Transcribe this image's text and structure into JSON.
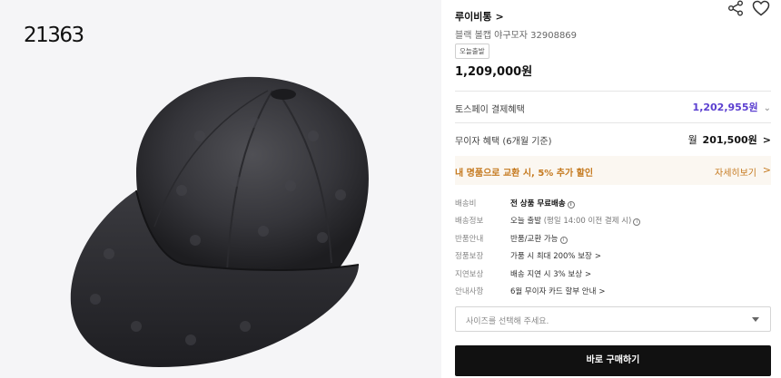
{
  "image_panel": {
    "image_id": "21363"
  },
  "product": {
    "brand": "루이비통",
    "brand_chevron": ">",
    "name": "블랙 볼캡 야구모자 32908869",
    "badge": "오늘출발",
    "price": "1,209,000원"
  },
  "benefits": {
    "toss_label": "토스페이 결제혜택",
    "toss_value": "1,202,955원",
    "toss_chevron": "⌄",
    "interest_label": "무이자 혜택 (6개월 기준)",
    "interest_prefix": "월",
    "interest_value": "201,500원",
    "interest_chevron": ">"
  },
  "exchange": {
    "label": "내 명품으로 교환 시, 5% 추가 할인",
    "link": "자세히보기",
    "chevron": ">"
  },
  "shipping": {
    "fee_label": "배송비",
    "fee_value": "전 상품 무료배송",
    "info_label": "배송정보",
    "info_value": "오늘 출발",
    "info_sub": "(평일 14:00 이전 결제 시)",
    "return_label": "반품안내",
    "return_value": "반품/교환 가능",
    "guarantee_label": "정품보장",
    "guarantee_value": "가품 시 최대 200% 보장",
    "delay_label": "지연보상",
    "delay_value": "배송 지연 시 3% 보상",
    "notice_label": "안내사항",
    "notice_value": "6월 무이자 카드 할부 안내",
    "chevron": ">",
    "info_icon_glyph": "i"
  },
  "size_select": {
    "placeholder": "사이즈를 선택해 주세요."
  },
  "buy_button": {
    "label": "바로 구매하기"
  },
  "colors": {
    "toss_purple": "#5b3fd0",
    "exchange_orange": "#c5791e",
    "exchange_bg": "#fbf7f1",
    "buy_button_bg": "#111111"
  },
  "icons": {
    "share": "share-icon",
    "heart": "heart-icon",
    "info": "info-icon",
    "select_arrow": "chevron-down-icon"
  }
}
